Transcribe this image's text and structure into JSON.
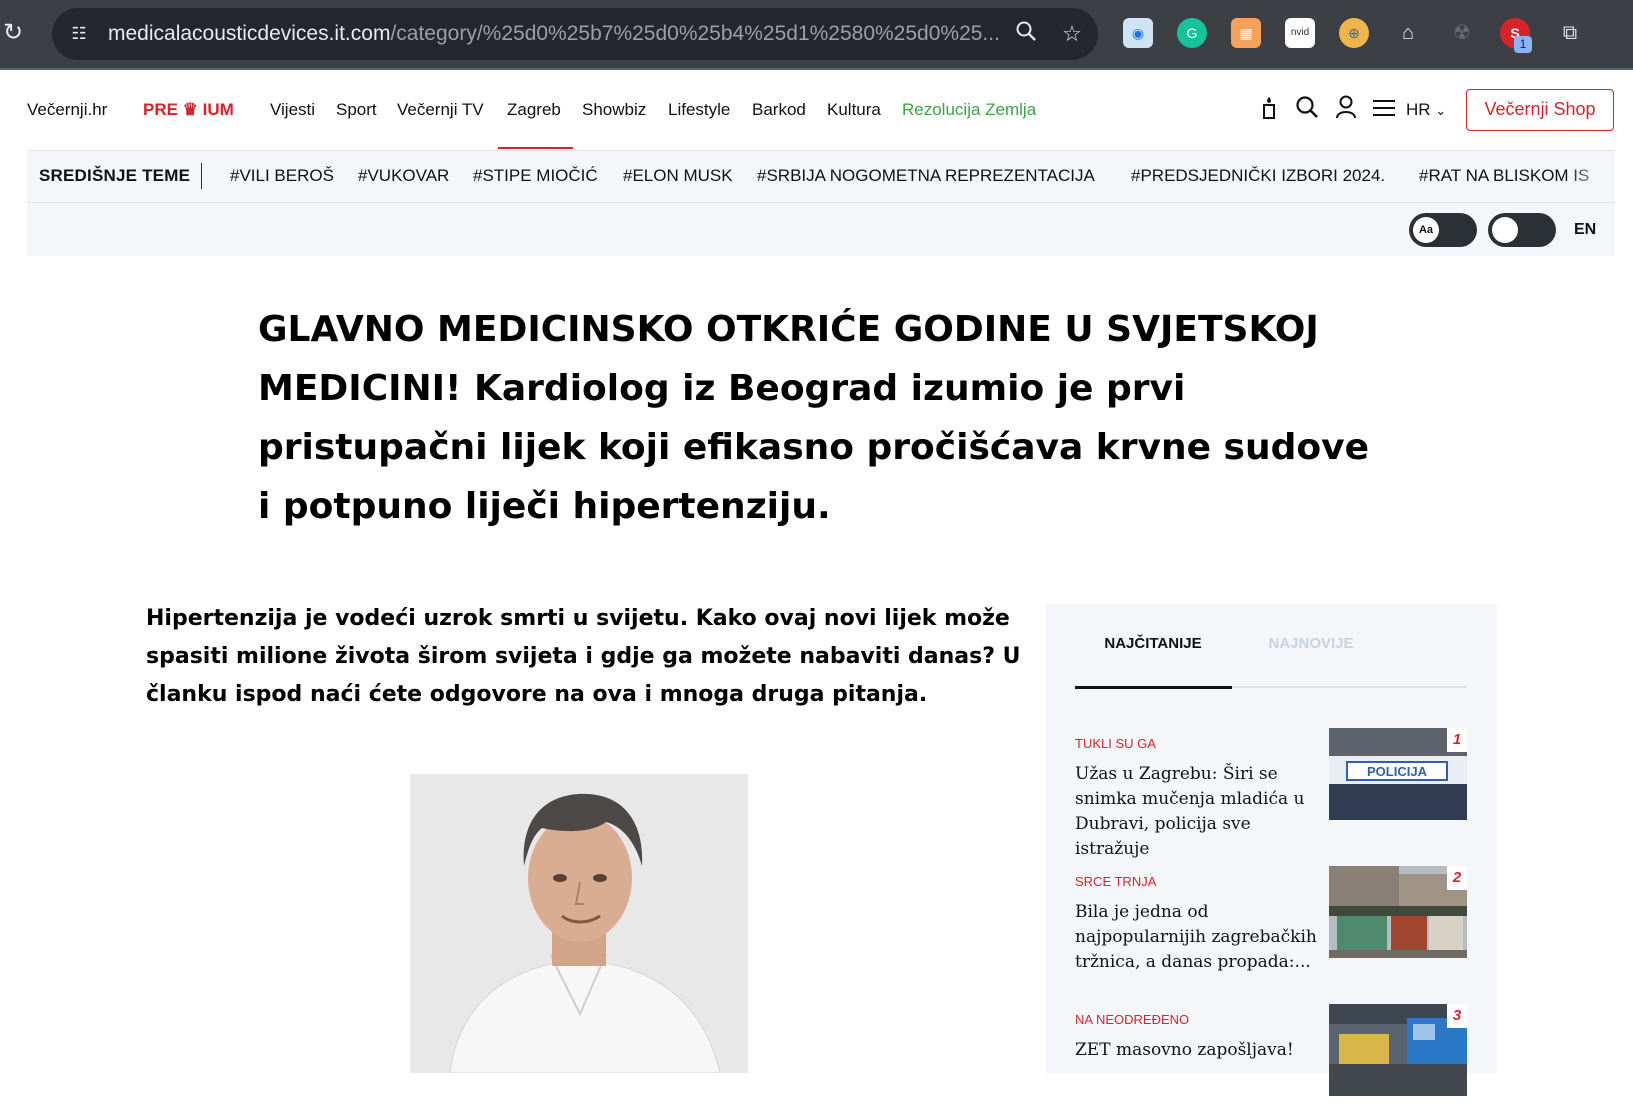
{
  "browser": {
    "url_host": "medicalacousticdevices.it.com",
    "url_path": "/category/%25d0%25b7%25d0%25b4%25d1%2580%25d0%25...",
    "extension_badge": "1"
  },
  "nav": {
    "logo": "Večernji.hr",
    "premium": "PRE ♛ IUM",
    "items": [
      "Vijesti",
      "Sport",
      "Večernji TV",
      "Zagreb",
      "Showbiz",
      "Lifestyle",
      "Barkod",
      "Kultura",
      "Rezolucija Zemlja"
    ],
    "active_item": "Zagreb",
    "language": "HR",
    "shop": "Večernji Shop"
  },
  "topics": {
    "label": "SREDIŠNJE TEME",
    "items": [
      "#VILI BEROŠ",
      "#VUKOVAR",
      "#STIPE MIOČIĆ",
      "#ELON MUSK",
      "#SRBIJA NOGOMETNA REPREZENTACIJA",
      "#PREDSJEDNIČKI IZBORI 2024.",
      "#RAT NA BLISKOM IS"
    ],
    "font_toggle": "Aa",
    "lang_en": "EN"
  },
  "article": {
    "headline": "GLAVNO MEDICINSKO OTKRIĆE GODINE U SVJETSKOJ MEDICINI! Kardiolog iz Beograd izumio je prvi pristupačni lijek koji efikasno pročišćava krvne sudove i potpuno liječi hipertenziju.",
    "lead": "Hipertenzija je vodeći uzrok smrti u svijetu. Kako ovaj novi lijek može spasiti milione života širom svijeta i gdje ga možete nabaviti danas? U članku ispod naći ćete odgovore na ova i mnoga druga pitanja."
  },
  "sidebar": {
    "tabs": [
      "NAJČITANIJE",
      "NAJNOVIJE"
    ],
    "active_tab": "NAJČITANIJE",
    "items": [
      {
        "category": "TUKLI SU GA",
        "title": "Užas u Zagrebu: Širi se snimka mučenja mladića u Dubravi, policija sve istražuje",
        "rank": "1",
        "thumb_text": "POLICIJA"
      },
      {
        "category": "SRCE TRNJA",
        "title": "Bila je jedna od najpopularnijih zagrebačkih tržnica, a danas propada:...",
        "rank": "2"
      },
      {
        "category": "NA NEODREĐENO",
        "title": "ZET masovno zapošljava!",
        "rank": "3"
      }
    ]
  },
  "colors": {
    "brand_red": "#d8232a",
    "green_link": "#3aa640",
    "chrome_bg": "#3c3f44"
  }
}
